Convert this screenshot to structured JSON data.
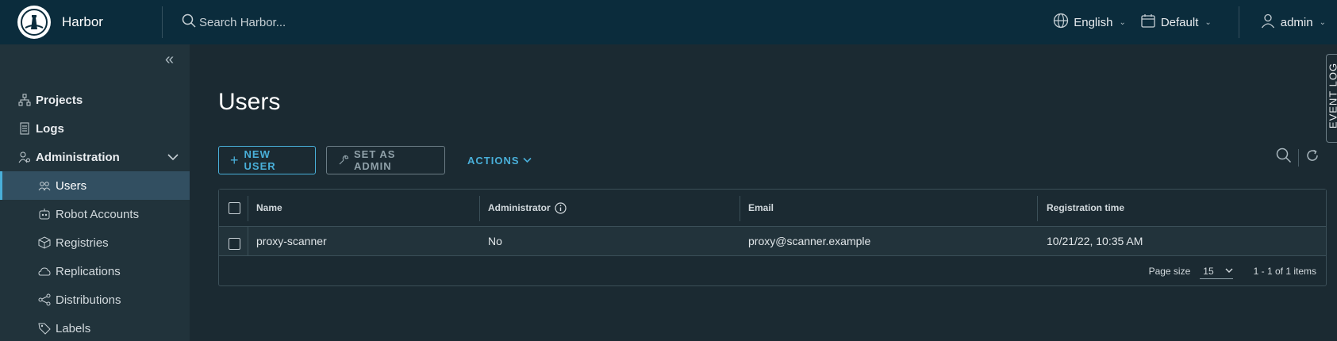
{
  "header": {
    "app_name": "Harbor",
    "search_placeholder": "Search Harbor...",
    "language": "English",
    "datetime_format": "Default",
    "user": "admin"
  },
  "sidebar": {
    "items": [
      {
        "label": "Projects",
        "icon": "projects-icon"
      },
      {
        "label": "Logs",
        "icon": "logs-icon"
      },
      {
        "label": "Administration",
        "icon": "administration-icon"
      }
    ],
    "admin_items": [
      {
        "label": "Users",
        "icon": "users-icon",
        "active": true
      },
      {
        "label": "Robot Accounts",
        "icon": "robot-icon"
      },
      {
        "label": "Registries",
        "icon": "registries-icon"
      },
      {
        "label": "Replications",
        "icon": "replications-icon"
      },
      {
        "label": "Distributions",
        "icon": "distributions-icon"
      },
      {
        "label": "Labels",
        "icon": "labels-icon"
      }
    ]
  },
  "main": {
    "title": "Users",
    "buttons": {
      "new_user": "NEW USER",
      "set_as_admin": "SET AS ADMIN",
      "actions": "ACTIONS"
    },
    "table": {
      "columns": [
        "Name",
        "Administrator",
        "Email",
        "Registration time"
      ],
      "rows": [
        {
          "name": "proxy-scanner",
          "administrator": "No",
          "email": "proxy@scanner.example",
          "registration_time": "10/21/22, 10:35 AM"
        }
      ],
      "footer": {
        "page_size_label": "Page size",
        "page_size": "15",
        "range": "1 - 1 of 1 items"
      }
    }
  },
  "event_log": {
    "label": "EVENT LOG"
  },
  "colors": {
    "accent": "#49afd9",
    "header_bg": "#0b2c3c",
    "sidebar_bg": "#21333b",
    "active_bg": "#324f61"
  }
}
